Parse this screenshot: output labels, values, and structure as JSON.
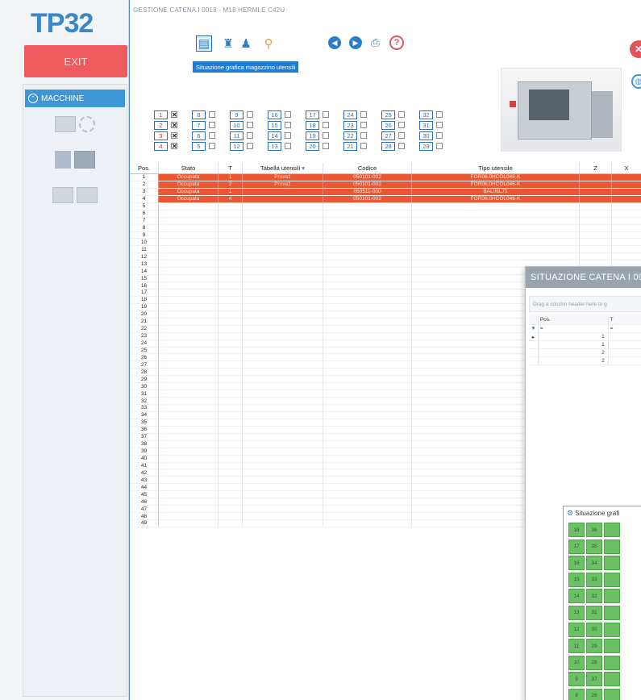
{
  "app": {
    "logo": "TP32",
    "exit_label": "EXIT",
    "machine_header": "MACCHINE",
    "window_title": "GESTIONE CATENA I 0018 - M18 HERMLE C42U",
    "tooltip": "Situazione grafica magazzino utensili"
  },
  "toolbar": {
    "help_label": "?",
    "close_label": "✕"
  },
  "slots": {
    "columns": [
      [
        {
          "n": "1",
          "c": true
        },
        {
          "n": "2",
          "c": true
        },
        {
          "n": "3",
          "c": true
        },
        {
          "n": "4",
          "c": true
        }
      ],
      [
        {
          "n": "8",
          "c": false
        },
        {
          "n": "7",
          "c": false
        },
        {
          "n": "6",
          "c": false
        },
        {
          "n": "5",
          "c": false
        }
      ],
      [
        {
          "n": "9",
          "c": false
        },
        {
          "n": "10",
          "c": false
        },
        {
          "n": "11",
          "c": false
        },
        {
          "n": "12",
          "c": false
        }
      ],
      [
        {
          "n": "16",
          "c": false
        },
        {
          "n": "15",
          "c": false
        },
        {
          "n": "14",
          "c": false
        },
        {
          "n": "13",
          "c": false
        }
      ],
      [
        {
          "n": "17",
          "c": false
        },
        {
          "n": "18",
          "c": false
        },
        {
          "n": "19",
          "c": false
        },
        {
          "n": "20",
          "c": false
        }
      ],
      [
        {
          "n": "24",
          "c": false
        },
        {
          "n": "23",
          "c": false
        },
        {
          "n": "22",
          "c": false
        },
        {
          "n": "21",
          "c": false
        }
      ],
      [
        {
          "n": "25",
          "c": false
        },
        {
          "n": "26",
          "c": false
        },
        {
          "n": "27",
          "c": false
        },
        {
          "n": "28",
          "c": false
        }
      ],
      [
        {
          "n": "32",
          "c": false
        },
        {
          "n": "31",
          "c": false
        },
        {
          "n": "30",
          "c": false
        },
        {
          "n": "29",
          "c": false
        }
      ]
    ]
  },
  "table": {
    "headers": {
      "pos": "Pos.",
      "stato": "Stato",
      "t": "T",
      "tabella": "Tabella utensili",
      "codice": "Codice",
      "tipo": "Tipo utensile",
      "z": "Z",
      "x": "X"
    },
    "rows": [
      {
        "pos": "1",
        "stato": "Occupata",
        "t": "1",
        "tabella": "Prova1",
        "codice": "050101-002",
        "tipo": "FOR06.0HCOL046-K"
      },
      {
        "pos": "2",
        "stato": "Occupata",
        "t": "2",
        "tabella": "Prova1",
        "codice": "050101-002",
        "tipo": "FOR06.0HCOL046-K"
      },
      {
        "pos": "3",
        "stato": "Occupata",
        "t": "1",
        "tabella": "",
        "codice": "050511-000",
        "tipo": "BAL06L71"
      },
      {
        "pos": "4",
        "stato": "Occupata",
        "t": "4",
        "tabella": "",
        "codice": "050101-002",
        "tipo": "FOR06.0HCOL046-K"
      }
    ],
    "total_rows": 49
  },
  "dialog": {
    "title": "SITUAZIONE CATENA I 00",
    "group_hint": "Drag a column header here to g",
    "col_pos": "Pos.",
    "col_t": "T",
    "filter": "=",
    "rows": [
      "1",
      "1",
      "2",
      "2"
    ]
  },
  "graphic": {
    "title": "Situazione grafi",
    "cells": [
      [
        "18",
        "36"
      ],
      [
        "17",
        "35"
      ],
      [
        "16",
        "34"
      ],
      [
        "15",
        "33"
      ],
      [
        "14",
        "32"
      ],
      [
        "13",
        "31"
      ],
      [
        "12",
        "30"
      ],
      [
        "11",
        "29"
      ],
      [
        "10",
        "28"
      ],
      [
        "9",
        "37"
      ],
      [
        "8",
        "26"
      ]
    ]
  }
}
